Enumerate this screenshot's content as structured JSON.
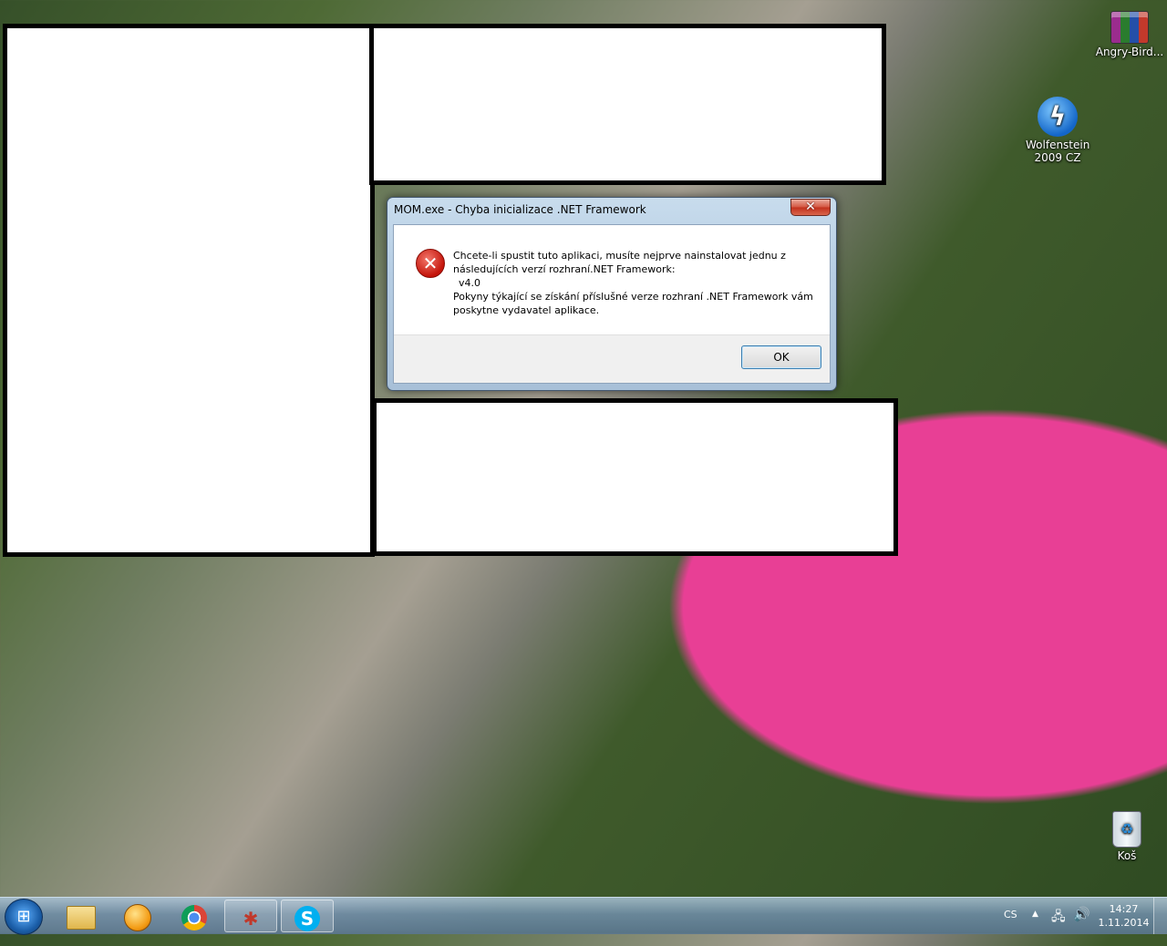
{
  "desktop": {
    "icons": [
      {
        "label": "Angry-Bird..."
      },
      {
        "label": "Wolfenstein 2009 CZ"
      },
      {
        "label": "Koš"
      }
    ]
  },
  "dialog": {
    "title": "MOM.exe - Chyba inicializace .NET Framework",
    "close_label": "✕",
    "message_lines": [
      "Chcete-li spustit tuto aplikaci, musíte nejprve nainstalovat jednu z",
      "následujících verzí rozhraní.NET Framework:",
      "v4.0",
      "Pokyny týkající se získání příslušné verze rozhraní .NET Framework vám",
      "poskytne vydavatel aplikace."
    ],
    "ok_label": "OK"
  },
  "taskbar": {
    "language": "CS",
    "time": "14:27",
    "date": "1.11.2014"
  }
}
